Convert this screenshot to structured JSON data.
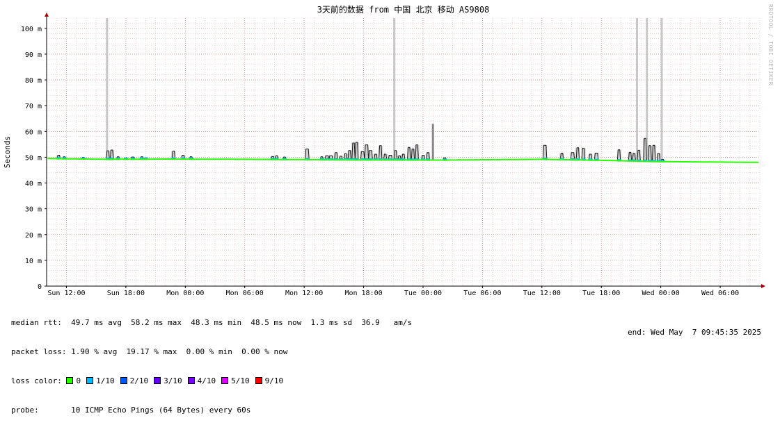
{
  "chart_data": {
    "type": "line",
    "title": "3天前的数据 from 中国 北京 移动 AS9808",
    "ylabel": "Seconds",
    "yunit": "m",
    "ylim": [
      0,
      104
    ],
    "yticks": [
      0,
      10,
      20,
      30,
      40,
      50,
      60,
      70,
      80,
      90,
      100
    ],
    "x_tick_labels": [
      "Sun 12:00",
      "Sun 18:00",
      "Mon 00:00",
      "Mon 06:00",
      "Mon 12:00",
      "Mon 18:00",
      "Tue 00:00",
      "Tue 06:00",
      "Tue 12:00",
      "Tue 18:00",
      "Wed 00:00",
      "Wed 06:00"
    ],
    "x_hours": [
      0,
      72
    ],
    "x_ticks_hours": [
      2,
      8,
      14,
      20,
      26,
      32,
      38,
      44,
      50,
      56,
      62,
      68
    ],
    "grid": true,
    "baseline": [
      [
        0,
        49.5
      ],
      [
        6,
        49.2
      ],
      [
        12,
        49.3
      ],
      [
        20,
        49.2
      ],
      [
        30,
        49.0
      ],
      [
        40,
        48.9
      ],
      [
        50,
        49.2
      ],
      [
        56,
        48.8
      ],
      [
        62,
        48.3
      ],
      [
        72,
        48.0
      ]
    ],
    "jitter_peaks": [
      [
        1.2,
        50.8
      ],
      [
        1.8,
        50.2
      ],
      [
        3.7,
        49.9
      ],
      [
        6.2,
        52.5
      ],
      [
        6.6,
        52.8
      ],
      [
        7.2,
        50.2
      ],
      [
        8.0,
        49.8
      ],
      [
        8.7,
        50.1
      ],
      [
        9.6,
        50.2
      ],
      [
        10.0,
        49.8
      ],
      [
        12.8,
        52.4
      ],
      [
        13.8,
        50.8
      ],
      [
        14.6,
        50.2
      ],
      [
        22.8,
        50.3
      ],
      [
        23.2,
        50.6
      ],
      [
        24.0,
        50.1
      ],
      [
        26.3,
        53.2
      ],
      [
        27.8,
        50.2
      ],
      [
        28.3,
        50.6
      ],
      [
        28.7,
        50.6
      ],
      [
        29.2,
        51.8
      ],
      [
        29.7,
        50.4
      ],
      [
        30.2,
        51.4
      ],
      [
        30.6,
        52.6
      ],
      [
        31.0,
        55.5
      ],
      [
        31.3,
        55.8
      ],
      [
        31.9,
        52.2
      ],
      [
        32.3,
        54.8
      ],
      [
        32.7,
        52.6
      ],
      [
        33.2,
        51.2
      ],
      [
        33.7,
        54.5
      ],
      [
        34.2,
        51.2
      ],
      [
        34.7,
        50.8
      ],
      [
        35.2,
        52.6
      ],
      [
        35.6,
        50.6
      ],
      [
        36.0,
        51.2
      ],
      [
        36.6,
        53.8
      ],
      [
        37.0,
        53.2
      ],
      [
        37.4,
        54.8
      ],
      [
        38.0,
        50.8
      ],
      [
        38.5,
        51.8
      ],
      [
        40.2,
        49.8
      ],
      [
        50.3,
        54.6
      ],
      [
        52.0,
        51.6
      ],
      [
        53.1,
        51.8
      ],
      [
        53.6,
        53.7
      ],
      [
        54.2,
        53.5
      ],
      [
        54.9,
        51.2
      ],
      [
        55.5,
        51.6
      ],
      [
        57.8,
        52.9
      ],
      [
        58.9,
        51.9
      ],
      [
        59.3,
        51.5
      ],
      [
        59.8,
        52.7
      ],
      [
        60.4,
        57.3
      ],
      [
        60.9,
        54.5
      ],
      [
        61.3,
        54.6
      ],
      [
        61.8,
        51.5
      ],
      [
        62.2,
        49.2
      ]
    ],
    "loss_spikes": [
      {
        "x": 6.1,
        "value": 104
      },
      {
        "x": 35.1,
        "value": 104
      },
      {
        "x": 59.6,
        "value": 104
      },
      {
        "x": 60.6,
        "value": 104
      },
      {
        "x": 62.1,
        "value": 104
      },
      {
        "x": 39.0,
        "value": 63
      }
    ],
    "series": [
      {
        "name": "0",
        "color": "#26ff00"
      },
      {
        "name": "1/10",
        "color": "#00b8ff"
      },
      {
        "name": "2/10",
        "color": "#0059ff"
      },
      {
        "name": "3/10",
        "color": "#5e00ff"
      },
      {
        "name": "4/10",
        "color": "#7e00ff"
      },
      {
        "name": "5/10",
        "color": "#dd00ff"
      },
      {
        "name": "9/10",
        "color": "#ff0000"
      }
    ]
  },
  "stats": {
    "median_rtt": "median rtt:  49.7 ms avg  58.2 ms max  48.3 ms min  48.5 ms now  1.3 ms sd  36.9   am/s",
    "packet_loss": "packet loss: 1.90 % avg  19.17 % max  0.00 % min  0.00 % now",
    "loss_color_label": "loss color:",
    "probe": "probe:       10 ICMP Echo Pings (64 Bytes) every 60s",
    "end": "end: Wed May  7 09:45:35 2025"
  },
  "watermark": "RRDTOOL / TOBI OETIKER"
}
